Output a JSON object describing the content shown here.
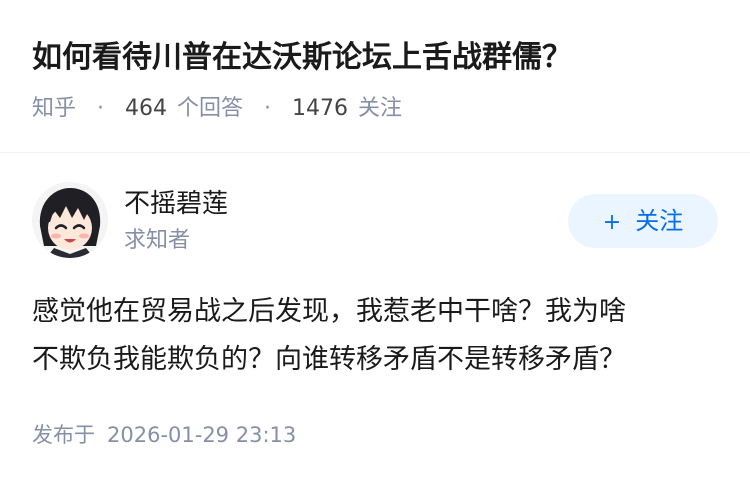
{
  "question": {
    "title": "如何看待川普在达沃斯论坛上舌战群儒？",
    "source": "知乎",
    "answer_count": "464",
    "answer_label": "个回答",
    "follower_count": "1476",
    "follower_label": "关注",
    "separator": "·"
  },
  "author": {
    "name": "不摇碧莲",
    "role": "求知者",
    "avatar_icon": "anime-avatar-icon",
    "follow_label": "关注",
    "follow_icon": "+"
  },
  "answer": {
    "lines": [
      "感觉他在贸易战之后发现，我惹老中干啥？我为啥",
      "不欺负我能欺负的？向谁转移矛盾不是转移矛盾？"
    ]
  },
  "publish": {
    "label": "发布于",
    "timestamp": "2026-01-29 23:13"
  },
  "colors": {
    "accent": "#056de8",
    "accent_bg": "#ebf5ff",
    "meta": "#8590a6",
    "text": "#1a1a1a"
  }
}
